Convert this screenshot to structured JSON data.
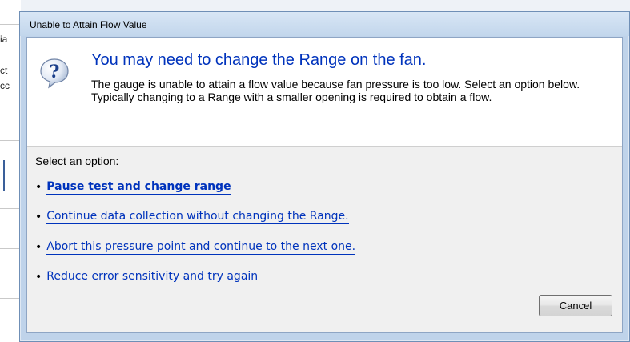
{
  "background": {
    "fragments": [
      "ia",
      "ct",
      "cc"
    ]
  },
  "dialog": {
    "title": "Unable to Attain Flow Value",
    "main_instruction": "You may need to change the Range on the fan.",
    "description": "The gauge is unable to attain a flow value because fan pressure is too low.  Select an option below. Typically changing to a Range with a smaller opening is required to obtain a flow.",
    "icon": "question-icon",
    "select_label": "Select an option:",
    "options": [
      {
        "label": "Pause test and change range",
        "bold": true
      },
      {
        "label": "Continue data collection without changing the Range.",
        "bold": false
      },
      {
        "label": "Abort this pressure point and continue to the next one.",
        "bold": false
      },
      {
        "label": "Reduce error sensitivity and try again",
        "bold": false
      }
    ],
    "cancel_label": "Cancel"
  },
  "colors": {
    "link": "#0033bc",
    "title_bar": "#c2d6ec",
    "content_bg": "#f0f0f0"
  }
}
